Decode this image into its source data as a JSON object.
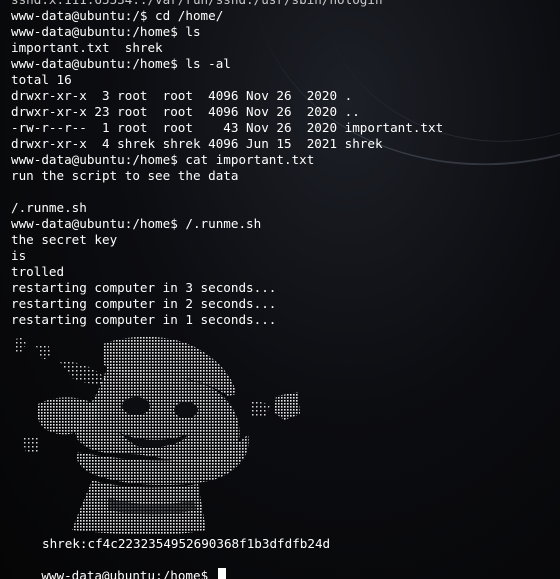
{
  "terminal": {
    "background": "#0c0d11",
    "text_color": "#ffffff",
    "lines": [
      "sshd:x:111:65534::/var/run/sshd:/usr/sbin/nologin",
      "www-data@ubuntu:/$ cd /home/",
      "www-data@ubuntu:/home$ ls",
      "important.txt  shrek",
      "www-data@ubuntu:/home$ ls -al",
      "total 16",
      "drwxr-xr-x  3 root  root  4096 Nov 26  2020 .",
      "drwxr-xr-x 23 root  root  4096 Nov 26  2020 ..",
      "-rw-r--r--  1 root  root    43 Nov 26  2020 important.txt",
      "drwxr-xr-x  4 shrek shrek 4096 Jun 15  2021 shrek",
      "www-data@ubuntu:/home$ cat important.txt",
      "run the script to see the data",
      "",
      "/.runme.sh",
      "www-data@ubuntu:/home$ /.runme.sh",
      "the secret key",
      "is",
      "trolled",
      "restarting computer in 3 seconds...",
      "restarting computer in 2 seconds...",
      "restarting computer in 1 seconds..."
    ],
    "secret_key_line": "shrek:cf4c2232354952690368f1b3dfdfb24d",
    "prompt": "www-data@ubuntu:/home$ "
  }
}
